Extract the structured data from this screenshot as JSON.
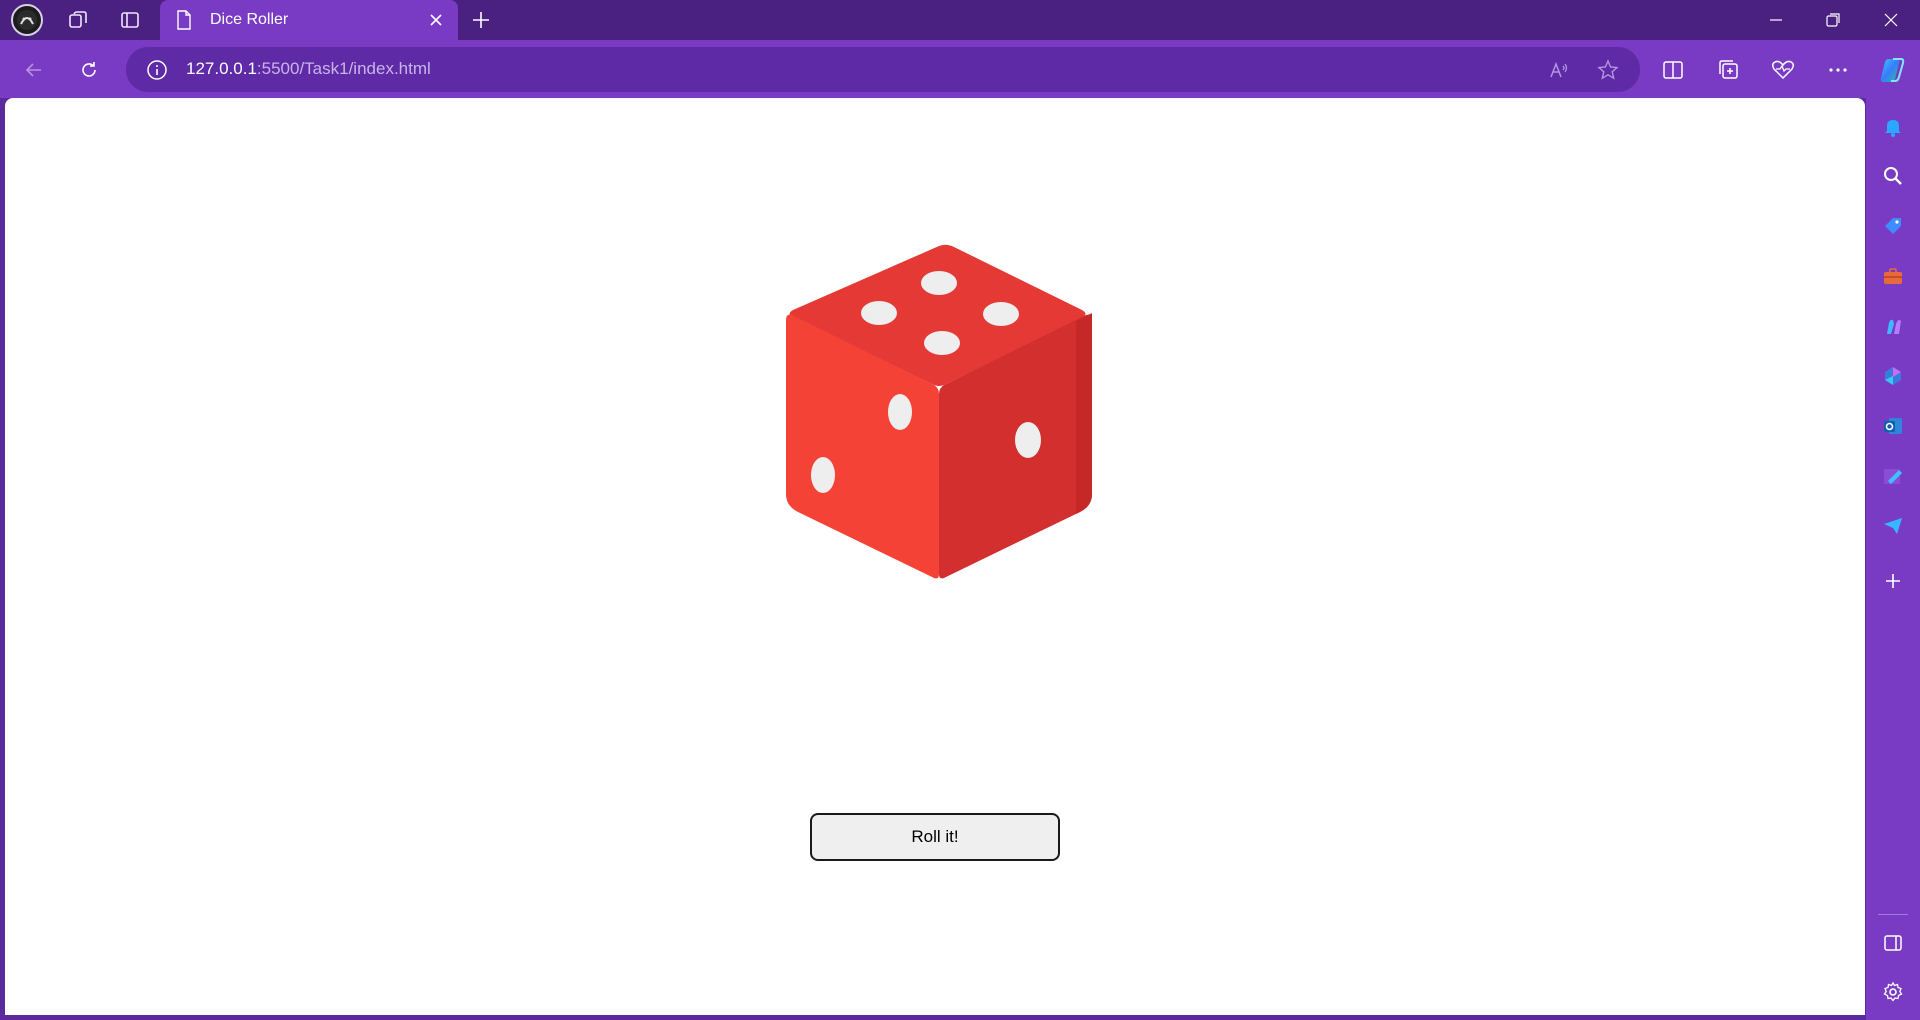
{
  "browser": {
    "tab": {
      "title": "Dice Roller",
      "icon": "page-icon"
    },
    "address": {
      "host": "127.0.0.1",
      "rest": ":5500/Task1/index.html"
    },
    "colors": {
      "frame": "#4a2080",
      "toolbar": "#7a3bc4",
      "address_bg": "#5e2aa6"
    },
    "toolbar_icons": [
      "read-aloud-icon",
      "favorite-star-icon",
      "split-screen-icon",
      "collections-icon",
      "browser-essentials-icon",
      "more-icon",
      "copilot-icon"
    ],
    "sidebar_icons": [
      "notification-icon",
      "search-icon",
      "shopping-icon",
      "tools-icon",
      "games-icon",
      "microsoft-365-icon",
      "outlook-icon",
      "designer-icon",
      "drop-icon",
      "add-icon",
      "hide-sidebar-icon",
      "settings-icon"
    ]
  },
  "page": {
    "dice": {
      "top_face": 4,
      "left_face": 2,
      "right_face": 1,
      "color": "#f44336"
    },
    "roll_button_label": "Roll it!"
  }
}
